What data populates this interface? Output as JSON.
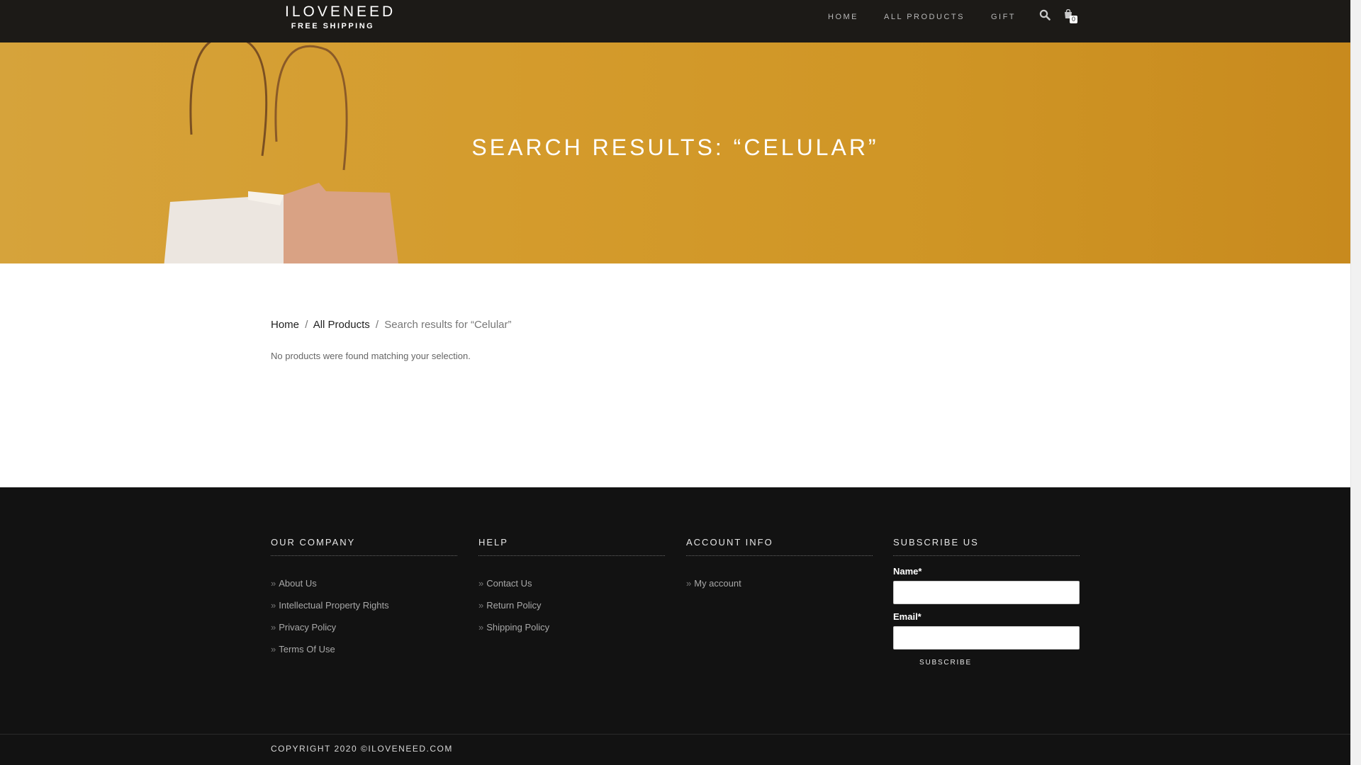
{
  "header": {
    "logo_title": "ILOVENEED",
    "logo_tagline": "FREE SHIPPING",
    "nav": [
      {
        "label": "HOME"
      },
      {
        "label": "ALL PRODUCTS"
      },
      {
        "label": "GIFT"
      }
    ],
    "search_icon": "search-icon",
    "cart_icon": "shopping-bag-icon",
    "cart_count": "0"
  },
  "hero": {
    "title": "SEARCH RESULTS: “CELULAR”"
  },
  "breadcrumb": {
    "home": "Home",
    "sep1": "/",
    "all_products": "All Products",
    "sep2": "/",
    "current": "Search results for “Celular”"
  },
  "main": {
    "message": "No products were found matching your selection."
  },
  "footer": {
    "our_company": {
      "title": "OUR COMPANY",
      "links": [
        "About Us",
        "Intellectual Property Rights",
        "Privacy Policy",
        "Terms Of Use"
      ]
    },
    "help": {
      "title": "HELP",
      "links": [
        "Contact Us",
        "Return Policy",
        "Shipping Policy"
      ]
    },
    "account_info": {
      "title": "ACCOUNT INFO",
      "links": [
        "My account"
      ]
    },
    "subscribe": {
      "title": "SUBSCRIBE US",
      "name_label": "Name*",
      "name_value": "",
      "email_label": "Email*",
      "email_value": "",
      "button_label": "SUBSCRIBE"
    },
    "bullet": "»",
    "copyright": "COPYRIGHT 2020 ©ILOVENEED.COM"
  },
  "colors": {
    "header_bg": "#1c1a17",
    "hero_bg": "#d49b2c",
    "footer_bg": "#121212"
  }
}
